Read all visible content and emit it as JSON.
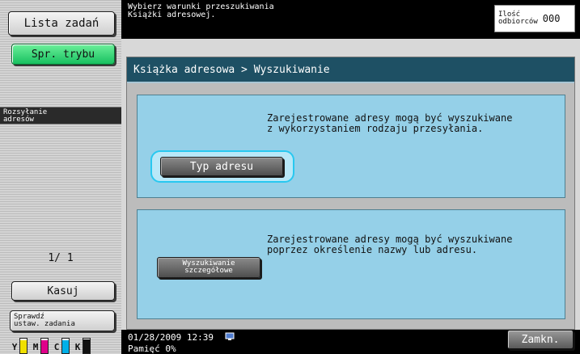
{
  "left_panel": {
    "job_list_label": "Lista zadań",
    "mode_check_label": "Spr. trybu",
    "section_tab_label": "Rozsyłanie\nadresów",
    "page_counter": "1/  1",
    "delete_label": "Kasuj",
    "check_job_label": "Sprawdź\nustaw. zadania",
    "toner": [
      {
        "label": "Y",
        "color": "#f0e000",
        "level": 0.9
      },
      {
        "label": "M",
        "color": "#e0008a",
        "level": 0.9
      },
      {
        "label": "C",
        "color": "#00b0e8",
        "level": 0.9
      },
      {
        "label": "K",
        "color": "#111111",
        "level": 0.95
      }
    ]
  },
  "header": {
    "message": "Wybierz warunki przeszukiwania\nKsiążki adresowej.",
    "recipients_label": "Ilość\nodbiorców",
    "recipients_count": "000"
  },
  "main": {
    "breadcrumb": "Książka adresowa > Wyszukiwanie",
    "sections": [
      {
        "button_label": "Typ adresu",
        "description": "Zarejestrowane adresy mogą być wyszukiwane\nz wykorzystaniem rodzaju przesyłania."
      },
      {
        "button_label": "Wyszukiwanie\nszczegółowe",
        "description": "Zarejestrowane adresy mogą być wyszukiwane\npoprzez określenie nazwy lub adresu."
      }
    ]
  },
  "footer": {
    "datetime": "01/28/2009   12:39",
    "memory": "Pamięć       0%",
    "close_label": "Zamkn."
  },
  "colors": {
    "breadcrumb_bg": "#1e5064",
    "section_bg": "#95d0e8",
    "highlight_ring": "#28c8f0",
    "mode_button": "#18c060"
  }
}
